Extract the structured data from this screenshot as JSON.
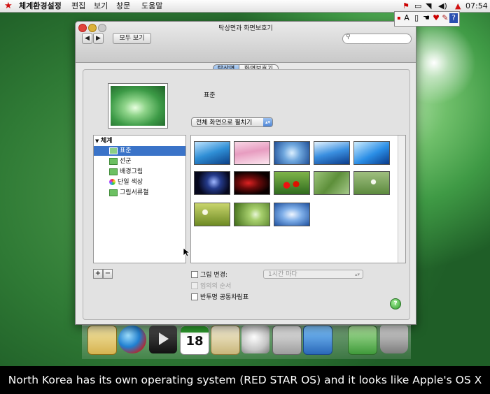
{
  "menubar": {
    "app": "체계환경설정",
    "items": [
      "편집",
      "보기",
      "창문",
      "도움말"
    ],
    "clock": "07:54"
  },
  "float_toolbar": {
    "a_label": "A",
    "help_label": "?"
  },
  "window": {
    "title": "탁상면과 화면보호기",
    "show_all": "모두 보기",
    "back": "◀",
    "forward": "▶",
    "search_placeholder": ""
  },
  "tabs": [
    {
      "label": "탁상면",
      "selected": true
    },
    {
      "label": "화면보호기",
      "selected": false
    }
  ],
  "current_picture": {
    "name": "표준"
  },
  "fit_popup": {
    "value": "전체 화면으로 펼치기"
  },
  "sidebar": {
    "group": "체계",
    "items": [
      {
        "label": "표준",
        "selected": true
      },
      {
        "label": "선군",
        "selected": false
      },
      {
        "label": "배경그림",
        "selected": false
      },
      {
        "label": "단일 색상",
        "selected": false
      },
      {
        "label": "그림서류철",
        "selected": false
      }
    ]
  },
  "buttons": {
    "add": "+",
    "remove": "−",
    "help": "?"
  },
  "options": {
    "change_picture": {
      "label": "그림 변경:",
      "checked": false
    },
    "interval": {
      "value": "1시간 마다"
    },
    "random_order": {
      "label": "임의의 순서",
      "checked": false,
      "enabled": false
    },
    "translucent_menubar": {
      "label": "반투명 공통차림표",
      "checked": false
    }
  },
  "caption": "North Korea has its own operating system (RED STAR OS) and it looks like Apple's OS X",
  "colors": {
    "accent": "#3a73c8",
    "star": "#d01010"
  }
}
